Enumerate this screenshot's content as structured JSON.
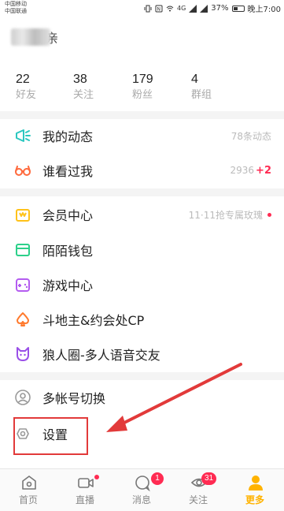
{
  "status_bar": {
    "carrier_1": "中国移动",
    "carrier_2": "中国联通",
    "battery_text": "37%",
    "network_text": "4G",
    "time": "晚上7:00"
  },
  "profile": {
    "name_visible_part": "亲"
  },
  "stats": [
    {
      "value": "22",
      "label": "好友"
    },
    {
      "value": "38",
      "label": "关注"
    },
    {
      "value": "179",
      "label": "粉丝"
    },
    {
      "value": "4",
      "label": "群组"
    }
  ],
  "menu": {
    "my_feed": {
      "label": "我的动态",
      "right": "78条动态"
    },
    "visitors": {
      "label": "谁看过我",
      "right": "2936",
      "right_extra": "+2"
    },
    "vip_center": {
      "label": "会员中心",
      "right": "11·11抢专属玫瑰"
    },
    "wallet": {
      "label": "陌陌钱包"
    },
    "game_center": {
      "label": "游戏中心"
    },
    "landlord": {
      "label": "斗地主&约会处CP"
    },
    "werewolf": {
      "label": "狼人圈-多人语音交友"
    },
    "switch_account": {
      "label": "多帐号切换"
    },
    "settings": {
      "label": "设置"
    }
  },
  "tabs": [
    {
      "label": "首页",
      "icon": "home-icon"
    },
    {
      "label": "直播",
      "icon": "video-icon"
    },
    {
      "label": "消息",
      "icon": "message-icon",
      "badge": "1"
    },
    {
      "label": "关注",
      "icon": "eye-icon",
      "badge": "31"
    },
    {
      "label": "更多",
      "icon": "person-icon",
      "active": true
    }
  ],
  "colors": {
    "accent": "#ffb300",
    "badge_red": "#ff2b52",
    "annotation_red": "#e23a3a"
  }
}
